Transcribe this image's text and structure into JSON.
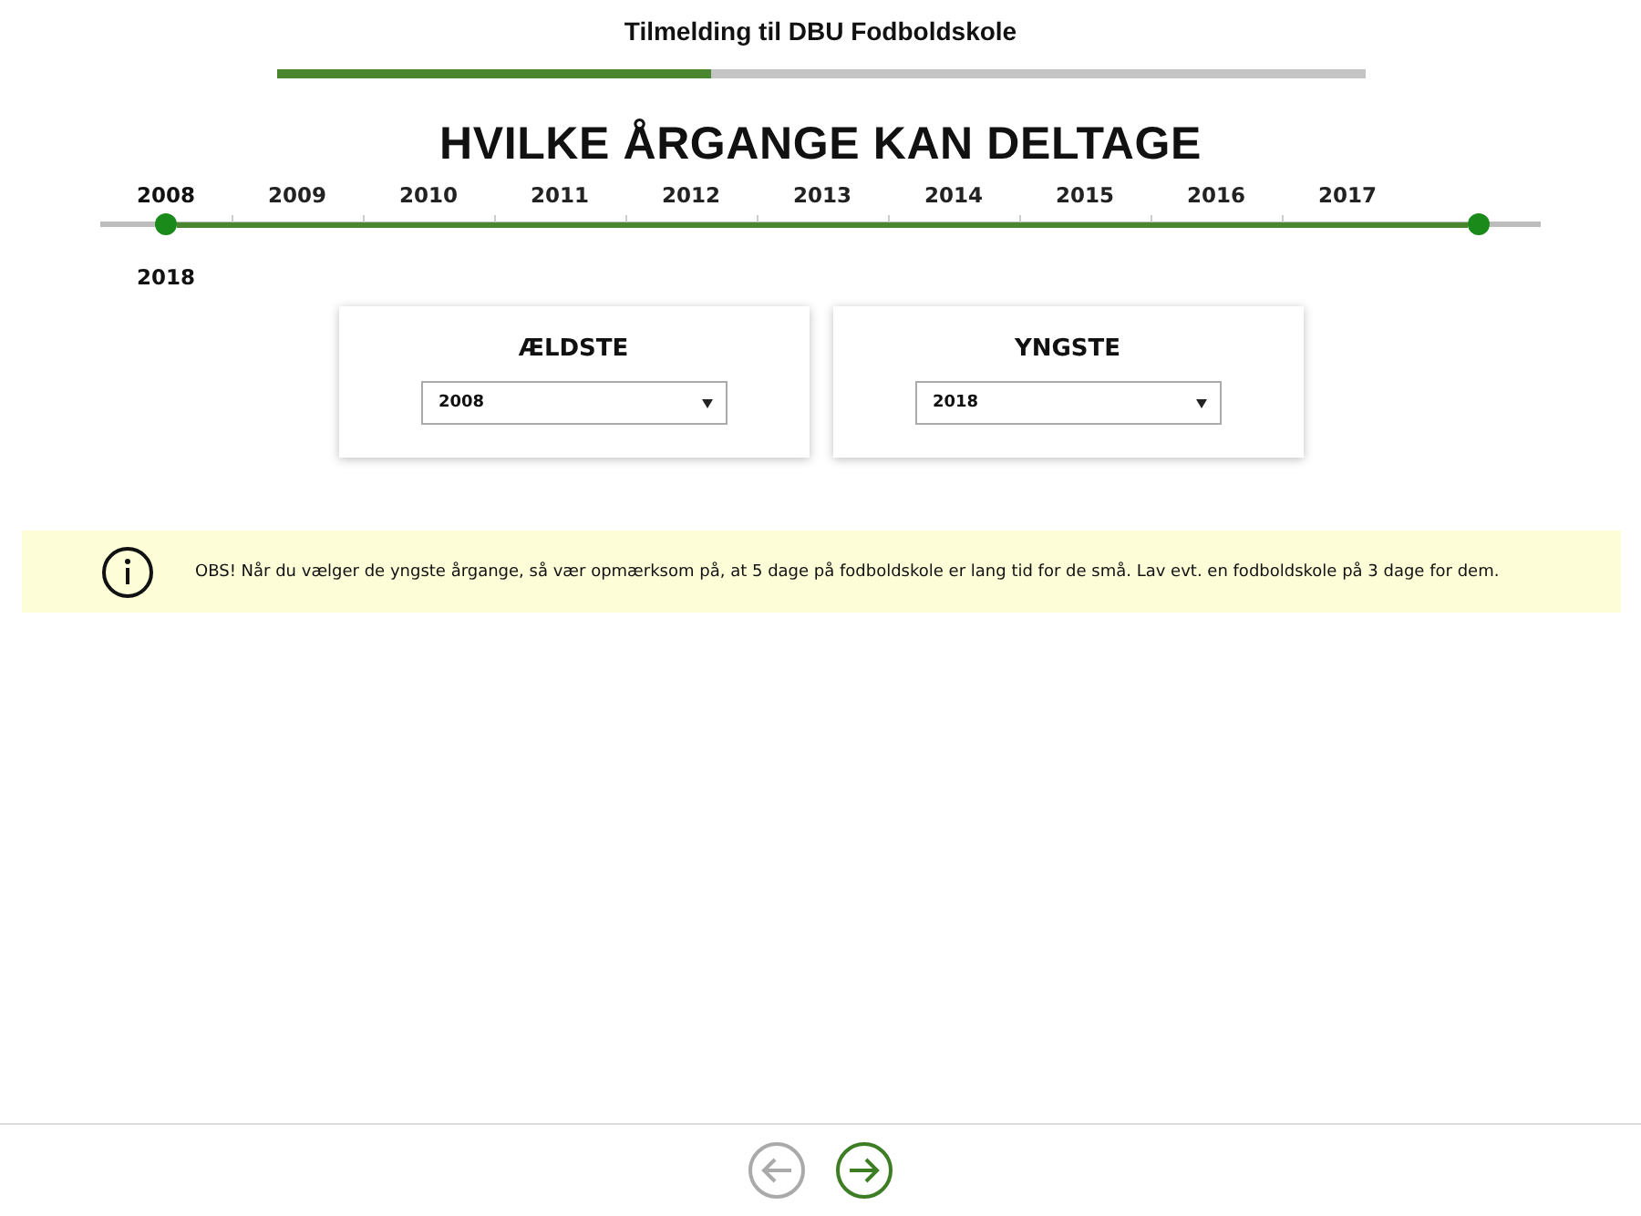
{
  "header": {
    "title": "Tilmelding til DBU Fodboldskole",
    "progress": {
      "level": 0.4
    }
  },
  "heading": "HVILKE ÅRGANGE KAN DELTAGE",
  "years": [
    {
      "label": "2008",
      "selected": true
    },
    {
      "label": "2009",
      "selected": false
    },
    {
      "label": "2010",
      "selected": false
    },
    {
      "label": "2011",
      "selected": false
    },
    {
      "label": "2012",
      "selected": false
    },
    {
      "label": "2013",
      "selected": false
    },
    {
      "label": "2014",
      "selected": false
    },
    {
      "label": "2015",
      "selected": false
    },
    {
      "label": "2016",
      "selected": false
    },
    {
      "label": "2017",
      "selected": false
    },
    {
      "label": "2018",
      "selected": true
    }
  ],
  "pickers": [
    {
      "label": "ÆLDSTE",
      "value": "2008"
    },
    {
      "label": "YNGSTE",
      "value": "2018"
    }
  ],
  "notice": "OBS! Når du vælger de yngste årgange, så vær opmærksom på, at 5 dage på fodboldskole er lang tid for de små. Lav evt. en fodboldskole på 3 dage for dem.",
  "nav": [
    {
      "kind": "back",
      "disabled": true
    },
    {
      "kind": "next",
      "disabled": false
    }
  ]
}
